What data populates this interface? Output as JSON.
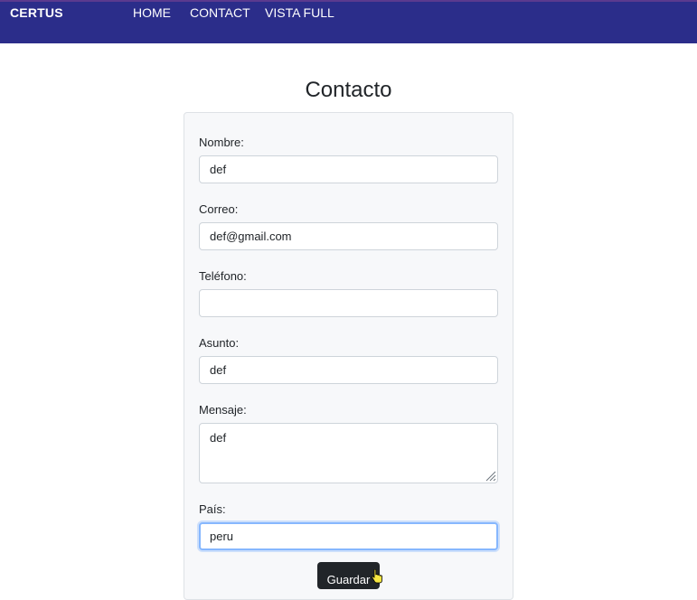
{
  "navbar": {
    "brand": "CERTUS",
    "links": [
      "HOME",
      "CONTACT",
      "VISTA FULL"
    ],
    "background_color": "#2b2d8a"
  },
  "page": {
    "title": "Contacto"
  },
  "form": {
    "fields": [
      {
        "label": "Nombre:",
        "value": "def"
      },
      {
        "label": "Correo:",
        "value": "def@gmail.com"
      },
      {
        "label": "Teléfono:",
        "value": ""
      },
      {
        "label": "Asunto:",
        "value": "def"
      },
      {
        "label": "Mensaje:",
        "value": "def"
      },
      {
        "label": "País:",
        "value": "peru"
      }
    ],
    "submit_label": "Guardar"
  }
}
